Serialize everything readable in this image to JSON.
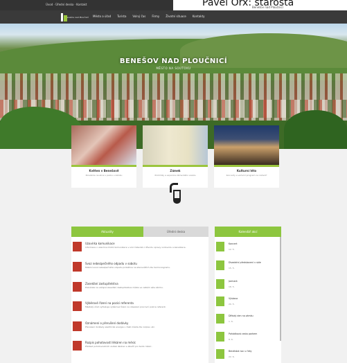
{
  "overlay": {
    "name": "Pavel Orx: starosta"
  },
  "topbar": {
    "note_left": "Úvod  ·  Úřední deska  ·  Kontakt",
    "note_right": "Benešov nad Ploučnicí"
  },
  "logo": {
    "text": "Benešov\nnad Ploučnicí"
  },
  "nav": {
    "items": [
      "Město a úřad",
      "Turista",
      "Volný čas",
      "Firmy",
      "Životní situace",
      "Kontakty"
    ]
  },
  "hero": {
    "title": "BENEŠOV NAD PLOUČNICÍ",
    "subtitle": "MĚSTO NA SOUTOKU"
  },
  "cards": [
    {
      "title": "Květen v Benešově",
      "subtitle": "Pozvánka na akce v parku u zámku"
    },
    {
      "title": "Zámek",
      "subtitle": "Prohlídky a expozice zámeckého areálu"
    },
    {
      "title": "Kulturní léto",
      "subtitle": "Koncerty a večerní program na nádvoří"
    }
  ],
  "news": {
    "tabs": [
      {
        "label": "Aktuality"
      },
      {
        "label": "Úřední deska"
      }
    ],
    "items": [
      {
        "title": "Uzavírka komunikace",
        "desc": "Informace o uzavírce místní komunikace v ulici Ústecká z důvodu opravy vodovodu a kanalizace."
      },
      {
        "title": "Svoz nebezpečného odpadu v sobotu",
        "desc": "Mobilní svoz nebezpečného odpadu proběhne na stanovištích dle harmonogramu."
      },
      {
        "title": "Zasedání zastupitelstva",
        "desc": "Pozvánka na veřejné zasedání zastupitelstva města ve velkém sále zámku."
      },
      {
        "title": "Výběrové řízení na pozici referenta",
        "desc": "Městský úřad vyhlašuje výběrové řízení na obsazení pracovní pozice referent."
      },
      {
        "title": "Oznámení o přerušení dodávky",
        "desc": "Přerušení dodávky elektrické energie v části města dle rozpisu ulic."
      },
      {
        "title": "Rozpis pohotovostí lékáren na měsíc",
        "desc": "Přehled pohotovostních služeb lékáren a lékařů pro tento měsíc."
      }
    ]
  },
  "events": {
    "title": "Kalendář akcí",
    "items": [
      {
        "title": "Koncert",
        "date": "12. 5."
      },
      {
        "title": "Divadelní představení v sále",
        "date": "15. 5."
      },
      {
        "title": "Jarmark",
        "date": "18. 5."
      },
      {
        "title": "Výstava",
        "date": "20. 5."
      },
      {
        "title": "Dětský den na zámku",
        "date": "1. 6."
      },
      {
        "title": "Pohádková cesta parkem",
        "date": "8. 6."
      },
      {
        "title": "Benátská noc u řeky",
        "date": "22. 6."
      }
    ]
  }
}
